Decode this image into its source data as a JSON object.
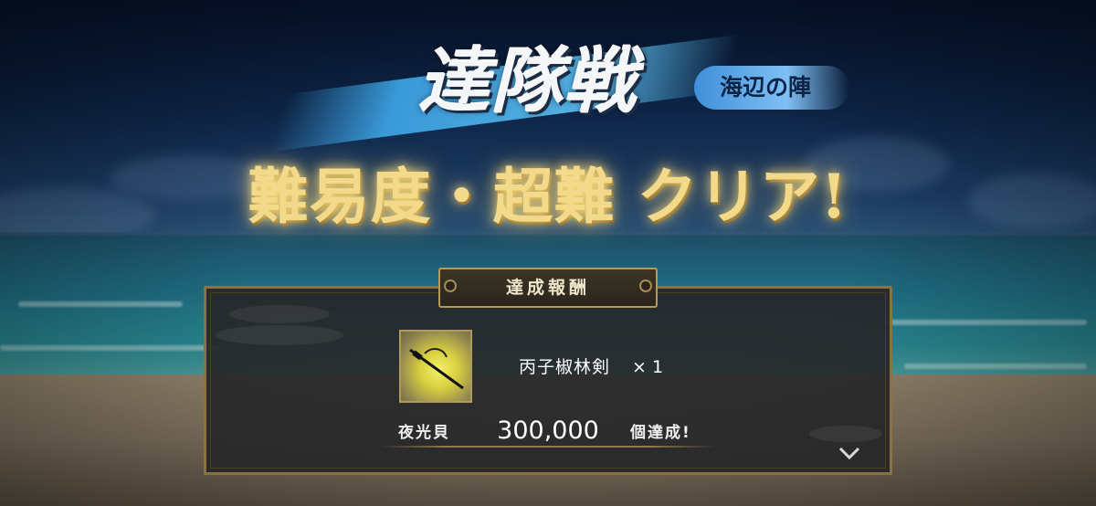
{
  "title": {
    "main": "達隊戦",
    "stage": "海辺の陣",
    "clear_message": "難易度・超難 クリア!"
  },
  "reward_panel": {
    "header": "達成報酬",
    "item": {
      "icon": "sword-icon",
      "name": "丙子椒林剣",
      "quantity": "× 1"
    },
    "condition": {
      "label": "夜光貝",
      "value": "300,000",
      "suffix": "個達成!"
    },
    "more_indicator": "chevron-down-icon"
  },
  "colors": {
    "title_glow": "#f3d98a",
    "panel_border": "#8b7341",
    "badge_blue": "#3f8fd9"
  }
}
